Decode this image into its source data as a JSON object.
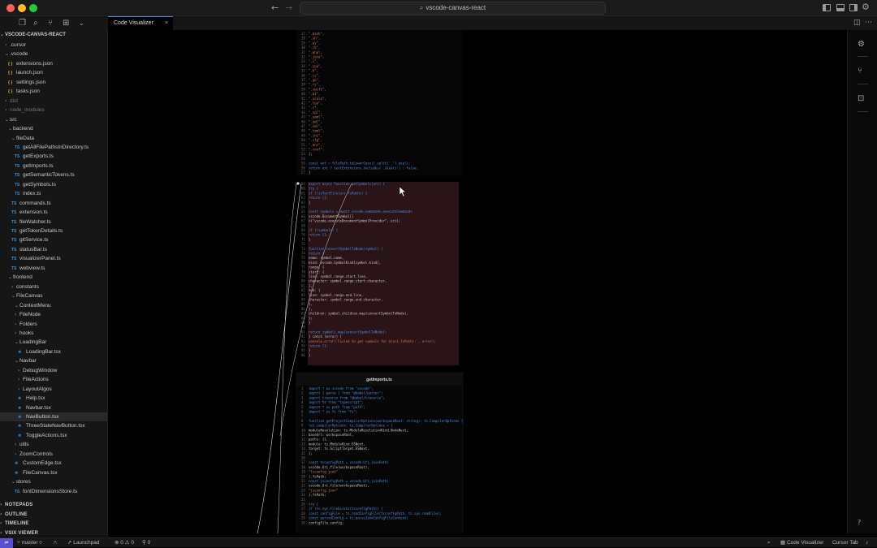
{
  "window": {
    "title": "vscode-canvas-react"
  },
  "tab": {
    "label": "Code Visualizer",
    "close": "×"
  },
  "sidebar": {
    "header": "VSCODE-CANVAS-REACT",
    "items": [
      {
        "label": ".cursor",
        "depth": 1,
        "kind": "folder",
        "open": false
      },
      {
        "label": ".vscode",
        "depth": 1,
        "kind": "folder",
        "open": true
      },
      {
        "label": "extensions.json",
        "depth": 2,
        "kind": "json"
      },
      {
        "label": "launch.json",
        "depth": 2,
        "kind": "json"
      },
      {
        "label": "settings.json",
        "depth": 2,
        "kind": "json"
      },
      {
        "label": "tasks.json",
        "depth": 2,
        "kind": "json"
      },
      {
        "label": "dist",
        "depth": 1,
        "kind": "folder",
        "open": false,
        "dim": true
      },
      {
        "label": "node_modules",
        "depth": 1,
        "kind": "folder",
        "open": false,
        "dim": true
      },
      {
        "label": "src",
        "depth": 1,
        "kind": "folder",
        "open": true
      },
      {
        "label": "backend",
        "depth": 2,
        "kind": "folder",
        "open": true
      },
      {
        "label": "fileData",
        "depth": 3,
        "kind": "folder",
        "open": true
      },
      {
        "label": "getAllFilePathsInDirectory.ts",
        "depth": 4,
        "kind": "ts"
      },
      {
        "label": "getExports.ts",
        "depth": 4,
        "kind": "ts"
      },
      {
        "label": "getImports.ts",
        "depth": 4,
        "kind": "ts"
      },
      {
        "label": "getSemanticTokens.ts",
        "depth": 4,
        "kind": "ts"
      },
      {
        "label": "getSymbols.ts",
        "depth": 4,
        "kind": "ts"
      },
      {
        "label": "index.ts",
        "depth": 4,
        "kind": "ts"
      },
      {
        "label": "commands.ts",
        "depth": 3,
        "kind": "ts"
      },
      {
        "label": "extension.ts",
        "depth": 3,
        "kind": "ts"
      },
      {
        "label": "fileWatcher.ts",
        "depth": 3,
        "kind": "ts"
      },
      {
        "label": "getTokenDetails.ts",
        "depth": 3,
        "kind": "ts"
      },
      {
        "label": "gitService.ts",
        "depth": 3,
        "kind": "ts"
      },
      {
        "label": "statusBar.ts",
        "depth": 3,
        "kind": "ts"
      },
      {
        "label": "visualizerPanel.ts",
        "depth": 3,
        "kind": "ts"
      },
      {
        "label": "webview.ts",
        "depth": 3,
        "kind": "ts"
      },
      {
        "label": "frontend",
        "depth": 2,
        "kind": "folder",
        "open": true
      },
      {
        "label": "constants",
        "depth": 3,
        "kind": "folder",
        "open": false
      },
      {
        "label": "FileCanvas",
        "depth": 3,
        "kind": "folder",
        "open": true
      },
      {
        "label": "ContextMenu",
        "depth": 4,
        "kind": "folder",
        "open": true
      },
      {
        "label": "FileNode",
        "depth": 4,
        "kind": "folder",
        "open": false
      },
      {
        "label": "Folders",
        "depth": 4,
        "kind": "folder",
        "open": false
      },
      {
        "label": "hooks",
        "depth": 4,
        "kind": "folder",
        "open": false
      },
      {
        "label": "LoadingBar",
        "depth": 4,
        "kind": "folder",
        "open": true
      },
      {
        "label": "LoadingBar.tsx",
        "depth": 5,
        "kind": "tsx"
      },
      {
        "label": "Navbar",
        "depth": 4,
        "kind": "folder",
        "open": true
      },
      {
        "label": "DebugWindow",
        "depth": 5,
        "kind": "folder",
        "open": false
      },
      {
        "label": "FileActions",
        "depth": 5,
        "kind": "folder",
        "open": false
      },
      {
        "label": "LayoutAlgos",
        "depth": 5,
        "kind": "folder",
        "open": false
      },
      {
        "label": "Help.tsx",
        "depth": 5,
        "kind": "tsx"
      },
      {
        "label": "Navbar.tsx",
        "depth": 5,
        "kind": "tsx"
      },
      {
        "label": "NavButton.tsx",
        "depth": 5,
        "kind": "tsx",
        "selected": true
      },
      {
        "label": "ThreeStateNavButton.tsx",
        "depth": 5,
        "kind": "tsx"
      },
      {
        "label": "ToggleActions.tsx",
        "depth": 5,
        "kind": "tsx"
      },
      {
        "label": "utils",
        "depth": 4,
        "kind": "folder",
        "open": false
      },
      {
        "label": "ZoomControls",
        "depth": 4,
        "kind": "folder",
        "open": false
      },
      {
        "label": "CustomEdge.tsx",
        "depth": 4,
        "kind": "tsx"
      },
      {
        "label": "FileCanvas.tsx",
        "depth": 4,
        "kind": "tsx"
      },
      {
        "label": "stores",
        "depth": 3,
        "kind": "folder",
        "open": true
      },
      {
        "label": "fontDimensionsStore.ts",
        "depth": 4,
        "kind": "ts"
      }
    ],
    "sections": [
      "NOTEPADS",
      "OUTLINE",
      "TIMELINE",
      "VSIX VIEWER"
    ]
  },
  "canvas": {
    "second_file_title": "getImports.ts",
    "top_block_lines": [
      "\".bash\",",
      "\".sh\",",
      "\".py\",",
      "\".rb\",",
      "\".php\",",
      "\".java\",",
      "\".c\",",
      "\".cpp\",",
      "\".h\",",
      "\".cs\",",
      "\".go\",",
      "\".rs\",",
      "\".swift\",",
      "\".kt\",",
      "\".scala\",",
      "\".lua\",",
      "\".r\",",
      "\".sql\",",
      "\".yaml\",",
      "\".yml\",",
      "\".xml\",",
      "\".toml\",",
      "\".ini\",",
      "\".cfg\",",
      "\".env\",",
      "\".conf\",",
      "];",
      "",
      "const ext = filePath.toLowerCase().split('.').pop();",
      "return ext ? textExtensions.includes(`.${ext}`) : false;",
      "}"
    ],
    "func_lines": [
      "export async function getSymbols(uri) {",
      "  try {",
      "    if (!isTextFile(uri.fsPath)) {",
      "      return [];",
      "    }",
      "",
      "    const symbols = await vscode.commands.executeCommand<",
      "      vscode.DocumentSymbol[]",
      "    >(\"vscode.executeDocumentSymbolProvider\", uri);",
      "",
      "    if (!symbols) {",
      "      return [];",
      "    }",
      "",
      "    function convertSymbolToNode(symbol) {",
      "      return {",
      "        name: symbol.name,",
      "        kind: vscode.SymbolKind[symbol.kind],",
      "        range: {",
      "          start: {",
      "            line: symbol.range.start.line,",
      "            character: symbol.range.start.character,",
      "          },",
      "          end: {",
      "            line: symbol.range.end.line,",
      "            character: symbol.range.end.character,",
      "          },",
      "        },",
      "        children: symbol.children.map(convertSymbolToNode),",
      "      };",
      "    }",
      "",
      "    return symbols.map(convertSymbolToNode);",
      "  } catch (error) {",
      "    console.error(`Failed to get symbols for ${uri.fsPath}:`, error);",
      "    return [];",
      "  }",
      "}"
    ],
    "import_lines": [
      "import * as vscode from \"vscode\";",
      "import { parse } from \"@babel/parser\";",
      "import traverse from \"@babel/traverse\";",
      "import ts from \"typescript\";",
      "import * as path from \"path\";",
      "import * as fs from \"fs\";",
      "",
      "function getProjectCompilerOptions(workspaceRoot: string): ts.CompilerOptions {",
      "  let compilerOptions: ts.CompilerOptions = {",
      "    moduleResolution: ts.ModuleResolutionKind.NodeNext,",
      "    baseUrl: workspaceRoot,",
      "    paths: {},",
      "    module: ts.ModuleKind.ESNext,",
      "    target: ts.ScriptTarget.ESNext,",
      "  };",
      "",
      "  const tsconfigPath = vscode.Uri.joinPath(",
      "    vscode.Uri.file(workspaceRoot),",
      "    \"tsconfig.json\"",
      "  ).fsPath;",
      "  const jsconfigPath = vscode.Uri.joinPath(",
      "    vscode.Uri.file(workspaceRoot),",
      "    \"jsconfig.json\"",
      "  ).fsPath;",
      "",
      "  try {",
      "    if (ts.sys.fileExists(tsconfigPath)) {",
      "      const configFile = ts.readConfigFile(tsconfigPath, ts.sys.readFile);",
      "      const parsedConfig = ts.parseJsonConfigFileContent(",
      "        configFile.config,"
    ]
  },
  "statusbar": {
    "branch": "master",
    "launchpad": "Launchpad",
    "problems": "0 ⚠ 0",
    "ports": "0",
    "code_visualizer": "Code Visualizer",
    "cursor_tab": "Cursor Tab"
  },
  "colors": {
    "highlight_fill": "#2b1418",
    "edge": "#d8d8d8",
    "accent": "#3b8fd6"
  }
}
